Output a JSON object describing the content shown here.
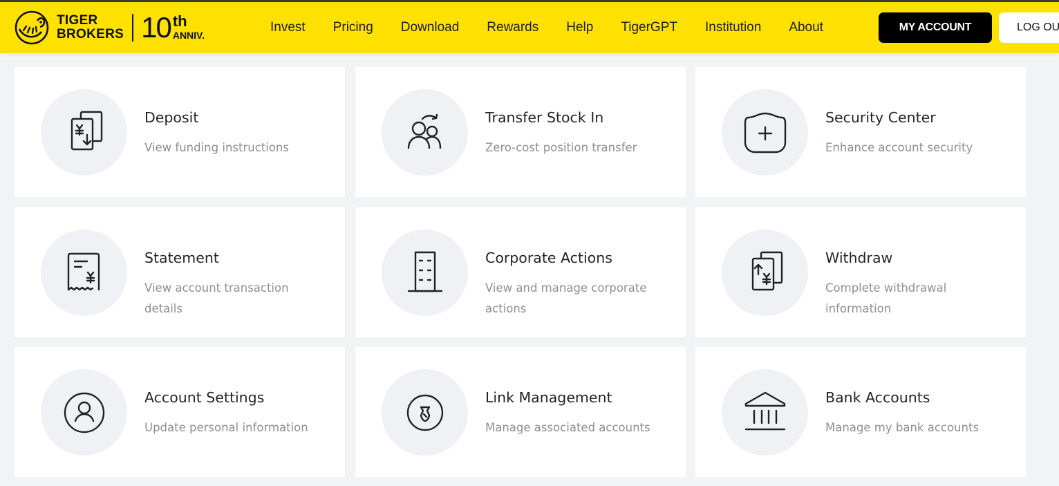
{
  "header": {
    "brand_line1": "TIGER",
    "brand_line2": "BROKERS",
    "anniv_number": "10",
    "anniv_suffix": "th",
    "anniv_text": "ANNIV.",
    "nav": [
      "Invest",
      "Pricing",
      "Download",
      "Rewards",
      "Help",
      "TigerGPT",
      "Institution",
      "About"
    ],
    "my_account": "MY ACCOUNT",
    "logout": "LOG OUT",
    "brand_color": "#ffe100"
  },
  "cards": [
    {
      "title": "Deposit",
      "desc": "View funding instructions",
      "icon": "deposit-icon"
    },
    {
      "title": "Transfer Stock In",
      "desc": "Zero-cost position transfer",
      "icon": "transfer-users-icon"
    },
    {
      "title": "Security Center",
      "desc": "Enhance account security",
      "icon": "shield-plus-icon"
    },
    {
      "title": "Statement",
      "desc": "View account transaction details",
      "icon": "receipt-icon"
    },
    {
      "title": "Corporate Actions",
      "desc": "View and manage corporate actions",
      "icon": "building-icon"
    },
    {
      "title": "Withdraw",
      "desc": "Complete withdrawal information",
      "icon": "withdraw-icon"
    },
    {
      "title": "Account Settings",
      "desc": "Update personal information",
      "icon": "user-circle-icon"
    },
    {
      "title": "Link Management",
      "desc": "Manage associated accounts",
      "icon": "link-icon"
    },
    {
      "title": "Bank Accounts",
      "desc": "Manage my bank accounts",
      "icon": "bank-icon"
    }
  ]
}
